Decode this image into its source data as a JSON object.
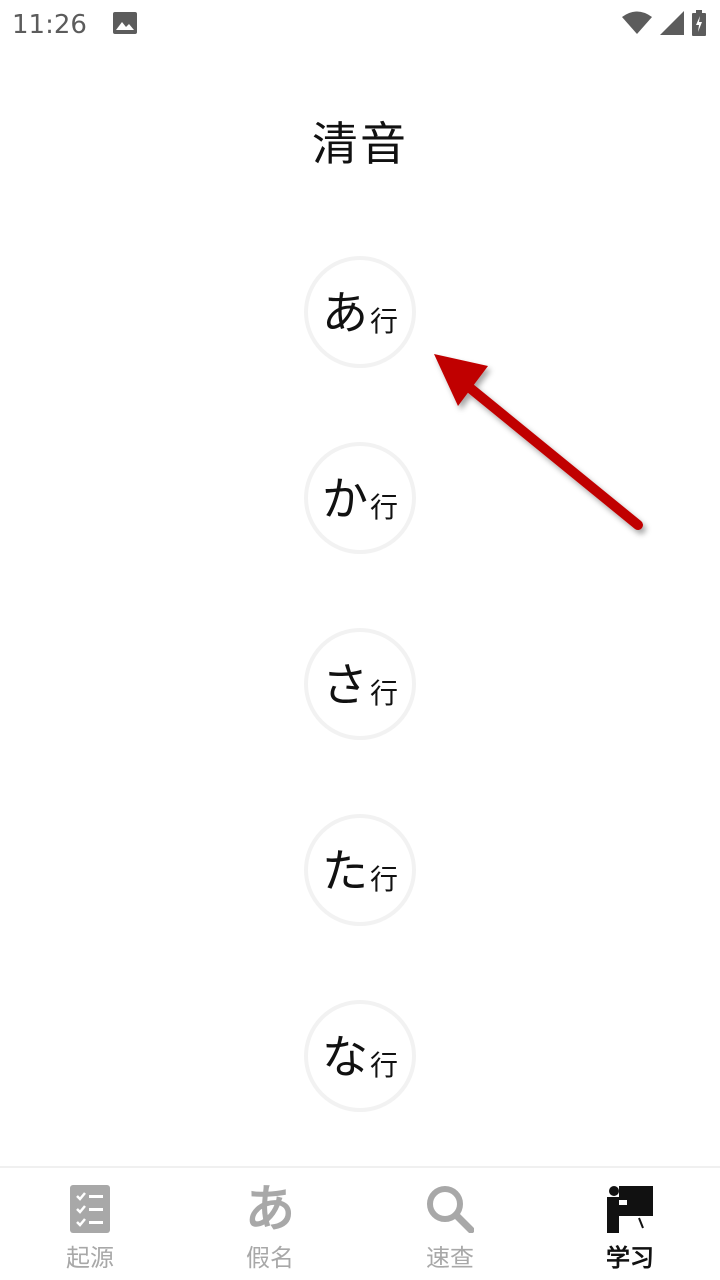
{
  "status_bar": {
    "time": "11:26",
    "icons": [
      "image-icon",
      "wifi-icon",
      "cell-signal-icon",
      "battery-charging-icon"
    ]
  },
  "page": {
    "title": "清音"
  },
  "rows": [
    {
      "kana": "あ",
      "suffix": "行"
    },
    {
      "kana": "か",
      "suffix": "行"
    },
    {
      "kana": "さ",
      "suffix": "行"
    },
    {
      "kana": "た",
      "suffix": "行"
    },
    {
      "kana": "な",
      "suffix": "行"
    }
  ],
  "annotation": {
    "arrow_color": "#c00000",
    "arrow_target": "あ行"
  },
  "bottom_nav": {
    "active": "学习",
    "items": [
      {
        "label": "起源",
        "icon": "checklist-icon"
      },
      {
        "label": "假名",
        "icon": "kana-a-icon",
        "glyph": "あ"
      },
      {
        "label": "速查",
        "icon": "search-icon"
      },
      {
        "label": "学习",
        "icon": "teacher-board-icon"
      }
    ]
  },
  "colors": {
    "active": "#111111",
    "inactive": "#a8a8a8",
    "circle_border": "#f2f2f2"
  }
}
